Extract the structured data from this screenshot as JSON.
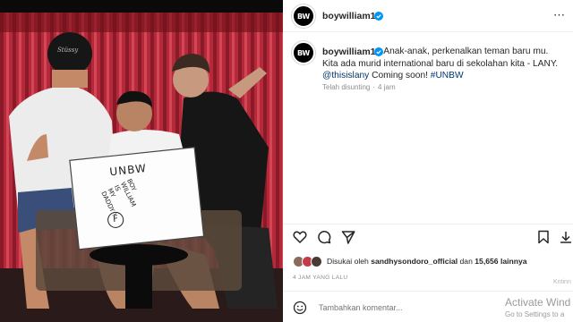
{
  "post": {
    "username": "boywilliam17",
    "avatar_text": "BW",
    "caption_line": "Anak-anak, perkenalkan teman baru mu. Kita ada murid international baru di sekolahan kita - LANY.",
    "mention": "@thisislany",
    "caption_tail": " Coming soon! ",
    "hashtag": "#UNBW",
    "edited_label": "Telah disunting",
    "edited_time": "4 jam",
    "liked_prefix": "Disukai oleh",
    "liked_by": "sandhysondoro_official",
    "liked_and": "dan",
    "liked_count": "15,656 lainnya",
    "timestamp": "4 JAM YANG LALU",
    "comment_placeholder": "Tambahkan komentar..."
  },
  "photo": {
    "sign_title": "UNBW",
    "sign_line1": "BOY",
    "sign_line2": "WILLIAM",
    "sign_line3": "IS",
    "sign_line4": "MY",
    "sign_line5": "DADDY !",
    "sign_grade": "F",
    "cap_logo": "Stüssy"
  },
  "overlay": {
    "activate_title": "Activate Wind",
    "activate_sub": "Go to Settings to a",
    "brand": "Kntinn"
  },
  "colors": {
    "mention": "#00376b",
    "curtain": "#b3283a",
    "verified": "#0095f6"
  }
}
